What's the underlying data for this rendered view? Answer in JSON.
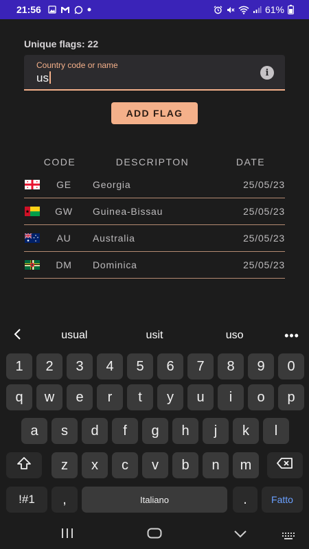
{
  "status": {
    "time": "21:56",
    "left_icons": [
      "gallery-icon",
      "gmail-icon",
      "whatsapp-icon",
      "dot-icon"
    ],
    "right_icons": [
      "alarm-icon",
      "mute-icon",
      "wifi-icon",
      "signal-icon"
    ],
    "battery": "61%"
  },
  "header": {
    "unique_flags": "Unique flags: 22"
  },
  "search": {
    "label": "Country code or name",
    "value": "us"
  },
  "add_button": "ADD FLAG",
  "table": {
    "columns": [
      "CODE",
      "DESCRIPTON",
      "DATE"
    ],
    "rows": [
      {
        "code": "GE",
        "description": "Georgia",
        "date": "25/05/23",
        "flag": "georgia-flag"
      },
      {
        "code": "GW",
        "description": "Guinea-Bissau",
        "date": "25/05/23",
        "flag": "guinea-bissau-flag"
      },
      {
        "code": "AU",
        "description": "Australia",
        "date": "25/05/23",
        "flag": "australia-flag"
      },
      {
        "code": "DM",
        "description": "Dominica",
        "date": "25/05/23",
        "flag": "dominica-flag"
      }
    ]
  },
  "keyboard": {
    "suggestions": [
      "usual",
      "usit",
      "uso"
    ],
    "numbers": [
      "1",
      "2",
      "3",
      "4",
      "5",
      "6",
      "7",
      "8",
      "9",
      "0"
    ],
    "row1": [
      "q",
      "w",
      "e",
      "r",
      "t",
      "y",
      "u",
      "i",
      "o",
      "p"
    ],
    "row2": [
      "a",
      "s",
      "d",
      "f",
      "g",
      "h",
      "j",
      "k",
      "l"
    ],
    "row3": [
      "z",
      "x",
      "c",
      "v",
      "b",
      "n",
      "m"
    ],
    "symbols": "!#1",
    "comma": ",",
    "space": "Italiano",
    "period": ".",
    "done": "Fatto"
  }
}
